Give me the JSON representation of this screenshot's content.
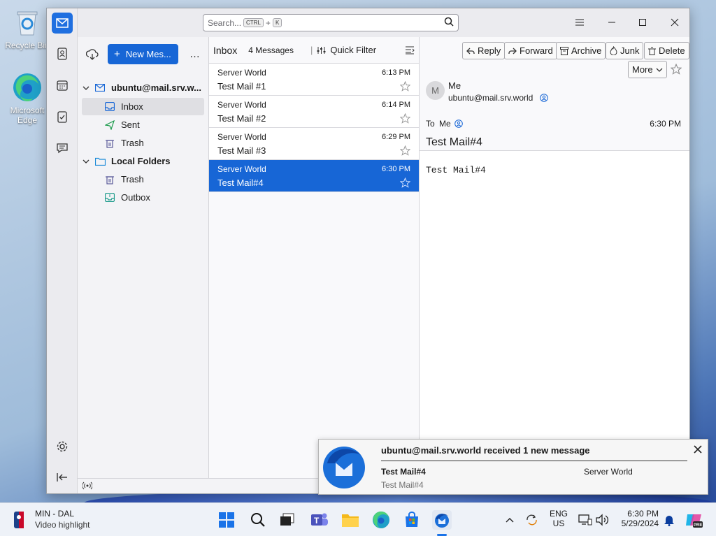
{
  "desktop": {
    "icons": [
      {
        "label": "Recycle Bin"
      },
      {
        "label": "Microsoft Edge"
      }
    ]
  },
  "search": {
    "placeholder": "Search...",
    "key1": "CTRL",
    "plus": "+",
    "key2": "K"
  },
  "folder_pane": {
    "new_message_label": "New Mes...",
    "more": "…",
    "account": "ubuntu@mail.srv.w...",
    "folders": [
      {
        "label": "Inbox",
        "icon": "inbox-icon"
      },
      {
        "label": "Sent",
        "icon": "send-icon"
      },
      {
        "label": "Trash",
        "icon": "trash-icon"
      }
    ],
    "local_folders": "Local Folders",
    "local": [
      {
        "label": "Trash",
        "icon": "trash-icon"
      },
      {
        "label": "Outbox",
        "icon": "outbox-icon"
      }
    ]
  },
  "message_list": {
    "folder_name": "Inbox",
    "count": "4 Messages",
    "quick_filter": "Quick Filter",
    "messages": [
      {
        "sender": "Server World",
        "subject": "Test Mail #1",
        "time": "6:13 PM"
      },
      {
        "sender": "Server World",
        "subject": "Test Mail #2",
        "time": "6:14 PM"
      },
      {
        "sender": "Server World",
        "subject": "Test Mail #3",
        "time": "6:29 PM"
      },
      {
        "sender": "Server World",
        "subject": "Test Mail#4",
        "time": "6:30 PM"
      }
    ]
  },
  "reader": {
    "buttons": {
      "reply": "Reply",
      "forward": "Forward",
      "archive": "Archive",
      "junk": "Junk",
      "delete": "Delete",
      "more": "More"
    },
    "avatar_letter": "M",
    "from_name": "Me",
    "from_email": "ubuntu@mail.srv.world",
    "to_label": "To",
    "to_name": "Me",
    "time": "6:30 PM",
    "subject": "Test Mail#4",
    "body": "Test Mail#4"
  },
  "notification": {
    "title": "ubuntu@mail.srv.world received 1 new message",
    "subject": "Test Mail#4",
    "sender": "Server World",
    "preview": "Test Mail#4"
  },
  "taskbar": {
    "widget_title": "MIN - DAL",
    "widget_subtitle": "Video highlight",
    "lang1": "ENG",
    "lang2": "US",
    "time": "6:30 PM",
    "date": "5/29/2024"
  },
  "colors": {
    "accent": "#1766d6",
    "window_bg": "#f9f9fb"
  }
}
